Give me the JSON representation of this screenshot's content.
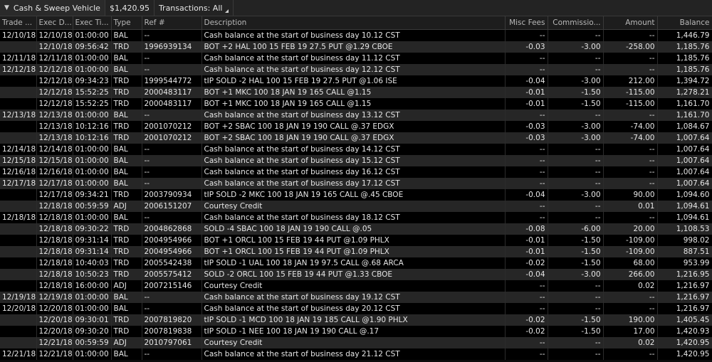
{
  "toolbar": {
    "account_label": "Cash & Sweep Vehicle",
    "balance": "$1,420.95",
    "filter_label": "Transactions: All"
  },
  "columns": [
    "Trade ...",
    "Exec D...",
    "Exec Ti...",
    "Type",
    "Ref #",
    "Description",
    "Misc Fees",
    "Commissio...",
    "Amount",
    "Balance"
  ],
  "rows": [
    [
      "12/10/18",
      "12/10/18",
      "01:00:00",
      "BAL",
      "--",
      "Cash balance at the start of business day 10.12 CST",
      "--",
      "--",
      "--",
      "1,446.79"
    ],
    [
      "",
      "12/10/18",
      "09:56:42",
      "TRD",
      "1996939134",
      "BOT +2 HAL 100 15 FEB 19 27.5 PUT @1.29 CBOE",
      "-0.03",
      "-3.00",
      "-258.00",
      "1,185.76"
    ],
    [
      "12/11/18",
      "12/11/18",
      "01:00:00",
      "BAL",
      "--",
      "Cash balance at the start of business day 11.12 CST",
      "--",
      "--",
      "--",
      "1,185.76"
    ],
    [
      "12/12/18",
      "12/12/18",
      "01:00:00",
      "BAL",
      "--",
      "Cash balance at the start of business day 12.12 CST",
      "--",
      "--",
      "--",
      "1,185.76"
    ],
    [
      "",
      "12/12/18",
      "09:34:23",
      "TRD",
      "1999544772",
      "tIP SOLD -2 HAL 100 15 FEB 19 27.5 PUT @1.06 ISE",
      "-0.04",
      "-3.00",
      "212.00",
      "1,394.72"
    ],
    [
      "",
      "12/12/18",
      "15:52:25",
      "TRD",
      "2000483117",
      "BOT +1 MKC 100 18 JAN 19 165 CALL @1.15",
      "-0.01",
      "-1.50",
      "-115.00",
      "1,278.21"
    ],
    [
      "",
      "12/12/18",
      "15:52:25",
      "TRD",
      "2000483117",
      "BOT +1 MKC 100 18 JAN 19 165 CALL @1.15",
      "-0.01",
      "-1.50",
      "-115.00",
      "1,161.70"
    ],
    [
      "12/13/18",
      "12/13/18",
      "01:00:00",
      "BAL",
      "--",
      "Cash balance at the start of business day 13.12 CST",
      "--",
      "--",
      "--",
      "1,161.70"
    ],
    [
      "",
      "12/13/18",
      "10:12:16",
      "TRD",
      "2001070212",
      "BOT +2 SBAC 100 18 JAN 19 190 CALL @.37 EDGX",
      "-0.03",
      "-3.00",
      "-74.00",
      "1,084.67"
    ],
    [
      "",
      "12/13/18",
      "10:12:16",
      "TRD",
      "2001070212",
      "BOT +2 SBAC 100 18 JAN 19 190 CALL @.37 EDGX",
      "-0.03",
      "-3.00",
      "-74.00",
      "1,007.64"
    ],
    [
      "12/14/18",
      "12/14/18",
      "01:00:00",
      "BAL",
      "--",
      "Cash balance at the start of business day 14.12 CST",
      "--",
      "--",
      "--",
      "1,007.64"
    ],
    [
      "12/15/18",
      "12/15/18",
      "01:00:00",
      "BAL",
      "--",
      "Cash balance at the start of business day 15.12 CST",
      "--",
      "--",
      "--",
      "1,007.64"
    ],
    [
      "12/16/18",
      "12/16/18",
      "01:00:00",
      "BAL",
      "--",
      "Cash balance at the start of business day 16.12 CST",
      "--",
      "--",
      "--",
      "1,007.64"
    ],
    [
      "12/17/18",
      "12/17/18",
      "01:00:00",
      "BAL",
      "--",
      "Cash balance at the start of business day 17.12 CST",
      "--",
      "--",
      "--",
      "1,007.64"
    ],
    [
      "",
      "12/17/18",
      "09:34:21",
      "TRD",
      "2003790934",
      "tIP SOLD -2 MKC 100 18 JAN 19 165 CALL @.45 CBOE",
      "-0.04",
      "-3.00",
      "90.00",
      "1,094.60"
    ],
    [
      "",
      "12/18/18",
      "00:59:59",
      "ADJ",
      "2006151207",
      "Courtesy Credit",
      "--",
      "--",
      "0.01",
      "1,094.61"
    ],
    [
      "12/18/18",
      "12/18/18",
      "01:00:00",
      "BAL",
      "--",
      "Cash balance at the start of business day 18.12 CST",
      "--",
      "--",
      "--",
      "1,094.61"
    ],
    [
      "",
      "12/18/18",
      "09:30:22",
      "TRD",
      "2004862868",
      "SOLD -4 SBAC 100 18 JAN 19 190 CALL @.05",
      "-0.08",
      "-6.00",
      "20.00",
      "1,108.53"
    ],
    [
      "",
      "12/18/18",
      "09:31:14",
      "TRD",
      "2004954966",
      "BOT +1 ORCL 100 15 FEB 19 44 PUT @1.09 PHLX",
      "-0.01",
      "-1.50",
      "-109.00",
      "998.02"
    ],
    [
      "",
      "12/18/18",
      "09:31:14",
      "TRD",
      "2004954966",
      "BOT +1 ORCL 100 15 FEB 19 44 PUT @1.09 PHLX",
      "-0.01",
      "-1.50",
      "-109.00",
      "887.51"
    ],
    [
      "",
      "12/18/18",
      "10:40:03",
      "TRD",
      "2005542438",
      "tIP SOLD -1 UAL 100 18 JAN 19 97.5 CALL @.68 ARCA",
      "-0.02",
      "-1.50",
      "68.00",
      "953.99"
    ],
    [
      "",
      "12/18/18",
      "10:50:23",
      "TRD",
      "2005575412",
      "SOLD -2 ORCL 100 15 FEB 19 44 PUT @1.33 CBOE",
      "-0.04",
      "-3.00",
      "266.00",
      "1,216.95"
    ],
    [
      "",
      "12/18/18",
      "16:00:00",
      "ADJ",
      "2007215146",
      "Courtesy Credit",
      "--",
      "--",
      "0.02",
      "1,216.97"
    ],
    [
      "12/19/18",
      "12/19/18",
      "01:00:00",
      "BAL",
      "--",
      "Cash balance at the start of business day 19.12 CST",
      "--",
      "--",
      "--",
      "1,216.97"
    ],
    [
      "12/20/18",
      "12/20/18",
      "01:00:00",
      "BAL",
      "--",
      "Cash balance at the start of business day 20.12 CST",
      "--",
      "--",
      "--",
      "1,216.97"
    ],
    [
      "",
      "12/20/18",
      "09:30:01",
      "TRD",
      "2007819820",
      "tIP SOLD -1 MCD 100 18 JAN 19 185 CALL @1.90 PHLX",
      "-0.02",
      "-1.50",
      "190.00",
      "1,405.45"
    ],
    [
      "",
      "12/20/18",
      "09:30:20",
      "TRD",
      "2007819838",
      "tIP SOLD -1 NEE 100 18 JAN 19 190 CALL @.17",
      "-0.02",
      "-1.50",
      "17.00",
      "1,420.93"
    ],
    [
      "",
      "12/21/18",
      "00:59:59",
      "ADJ",
      "2010797061",
      "Courtesy Credit",
      "--",
      "--",
      "0.02",
      "1,420.95"
    ],
    [
      "12/21/18",
      "12/21/18",
      "01:00:00",
      "BAL",
      "--",
      "Cash balance at the start of business day 21.12 CST",
      "--",
      "--",
      "--",
      "1,420.95"
    ]
  ]
}
